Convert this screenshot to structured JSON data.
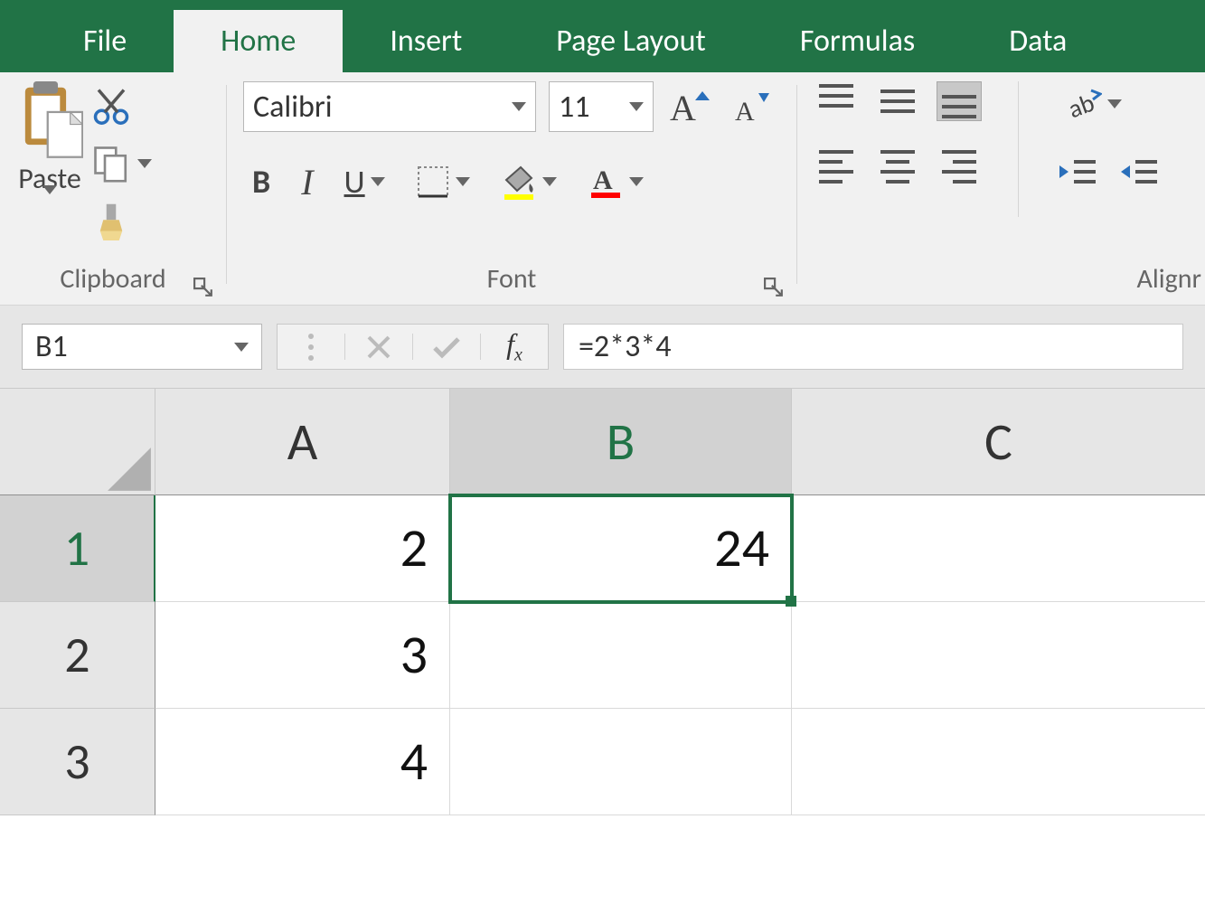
{
  "tabs": {
    "file": "File",
    "home": "Home",
    "insert": "Insert",
    "page_layout": "Page Layout",
    "formulas": "Formulas",
    "data": "Data",
    "active": "home"
  },
  "ribbon": {
    "clipboard": {
      "paste_label": "Paste",
      "group_label": "Clipboard"
    },
    "font": {
      "group_label": "Font",
      "font_name": "Calibri",
      "font_size": "11",
      "bold": "B",
      "italic": "I",
      "underline": "U"
    },
    "alignment": {
      "group_label": "Alignr",
      "wrap_label": ""
    }
  },
  "formula_bar": {
    "name_box": "B1",
    "fx_label": "fx",
    "formula": "=2*3*4"
  },
  "grid": {
    "columns": [
      "A",
      "B",
      "C"
    ],
    "rows": [
      "1",
      "2",
      "3"
    ],
    "active_cell": "B1",
    "cells": {
      "A1": "2",
      "B1": "24",
      "A2": "3",
      "A3": "4"
    }
  },
  "colors": {
    "brand": "#217346"
  }
}
